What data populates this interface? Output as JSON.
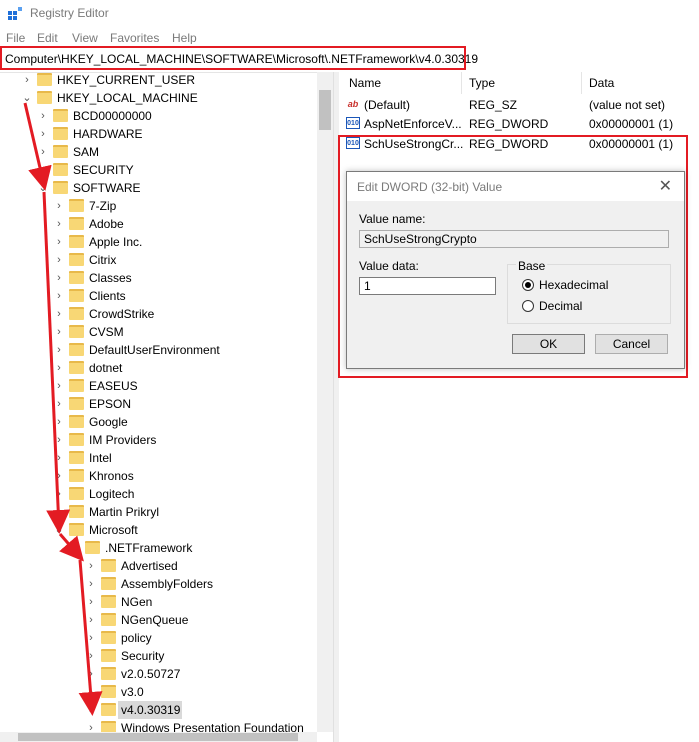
{
  "app": {
    "title": "Registry Editor"
  },
  "menu": [
    "File",
    "Edit",
    "View",
    "Favorites",
    "Help"
  ],
  "address": {
    "path": "Computer\\HKEY_LOCAL_MACHINE\\SOFTWARE\\Microsoft\\.NETFramework\\v4.0.30319"
  },
  "tree": [
    {
      "label": "HKEY_CURRENT_USER",
      "level": 1,
      "expanded": false
    },
    {
      "label": "HKEY_LOCAL_MACHINE",
      "level": 1,
      "expanded": true
    },
    {
      "label": "BCD00000000",
      "level": 2,
      "expanded": false
    },
    {
      "label": "HARDWARE",
      "level": 2,
      "expanded": false
    },
    {
      "label": "SAM",
      "level": 2,
      "expanded": false
    },
    {
      "label": "SECURITY",
      "level": 2,
      "expanded": false
    },
    {
      "label": "SOFTWARE",
      "level": 2,
      "expanded": true
    },
    {
      "label": "7-Zip",
      "level": 3,
      "expanded": false
    },
    {
      "label": "Adobe",
      "level": 3,
      "expanded": false
    },
    {
      "label": "Apple Inc.",
      "level": 3,
      "expanded": false
    },
    {
      "label": "Citrix",
      "level": 3,
      "expanded": false
    },
    {
      "label": "Classes",
      "level": 3,
      "expanded": false
    },
    {
      "label": "Clients",
      "level": 3,
      "expanded": false
    },
    {
      "label": "CrowdStrike",
      "level": 3,
      "expanded": false
    },
    {
      "label": "CVSM",
      "level": 3,
      "expanded": false
    },
    {
      "label": "DefaultUserEnvironment",
      "level": 3,
      "expanded": false
    },
    {
      "label": "dotnet",
      "level": 3,
      "expanded": false
    },
    {
      "label": "EASEUS",
      "level": 3,
      "expanded": false
    },
    {
      "label": "EPSON",
      "level": 3,
      "expanded": false
    },
    {
      "label": "Google",
      "level": 3,
      "expanded": false
    },
    {
      "label": "IM Providers",
      "level": 3,
      "expanded": false
    },
    {
      "label": "Intel",
      "level": 3,
      "expanded": false
    },
    {
      "label": "Khronos",
      "level": 3,
      "expanded": false
    },
    {
      "label": "Logitech",
      "level": 3,
      "expanded": false
    },
    {
      "label": "Martin Prikryl",
      "level": 3,
      "expanded": false
    },
    {
      "label": "Microsoft",
      "level": 3,
      "expanded": true
    },
    {
      "label": ".NETFramework",
      "level": 4,
      "expanded": true
    },
    {
      "label": "Advertised",
      "level": 5,
      "expanded": false
    },
    {
      "label": "AssemblyFolders",
      "level": 5,
      "expanded": false
    },
    {
      "label": "NGen",
      "level": 5,
      "expanded": false
    },
    {
      "label": "NGenQueue",
      "level": 5,
      "expanded": false
    },
    {
      "label": "policy",
      "level": 5,
      "expanded": false
    },
    {
      "label": "Security",
      "level": 5,
      "expanded": false
    },
    {
      "label": "v2.0.50727",
      "level": 5,
      "expanded": false
    },
    {
      "label": "v3.0",
      "level": 5,
      "expanded": false
    },
    {
      "label": "v4.0.30319",
      "level": 5,
      "expanded": false,
      "selected": true
    },
    {
      "label": "Windows Presentation Foundation",
      "level": 5,
      "expanded": false
    }
  ],
  "values": {
    "headers": {
      "name": "Name",
      "type": "Type",
      "data": "Data"
    },
    "rows": [
      {
        "icon": "string-value-icon",
        "name": "(Default)",
        "type": "REG_SZ",
        "data": "(value not set)"
      },
      {
        "icon": "dword-value-icon",
        "name": "AspNetEnforceV...",
        "type": "REG_DWORD",
        "data": "0x00000001 (1)"
      },
      {
        "icon": "dword-value-icon",
        "name": "SchUseStrongCr...",
        "type": "REG_DWORD",
        "data": "0x00000001 (1)"
      }
    ]
  },
  "dialog": {
    "title": "Edit DWORD (32-bit) Value",
    "value_name_label": "Value name:",
    "value_name": "SchUseStrongCrypto",
    "value_data_label": "Value data:",
    "value_data": "1",
    "base_label": "Base",
    "hex_label": "Hexadecimal",
    "dec_label": "Decimal",
    "base_selected": "Hexadecimal",
    "ok_label": "OK",
    "cancel_label": "Cancel"
  },
  "colors": {
    "highlight": "#e31b23",
    "folder": "#f8d775",
    "selection": "#d9d9d9"
  }
}
